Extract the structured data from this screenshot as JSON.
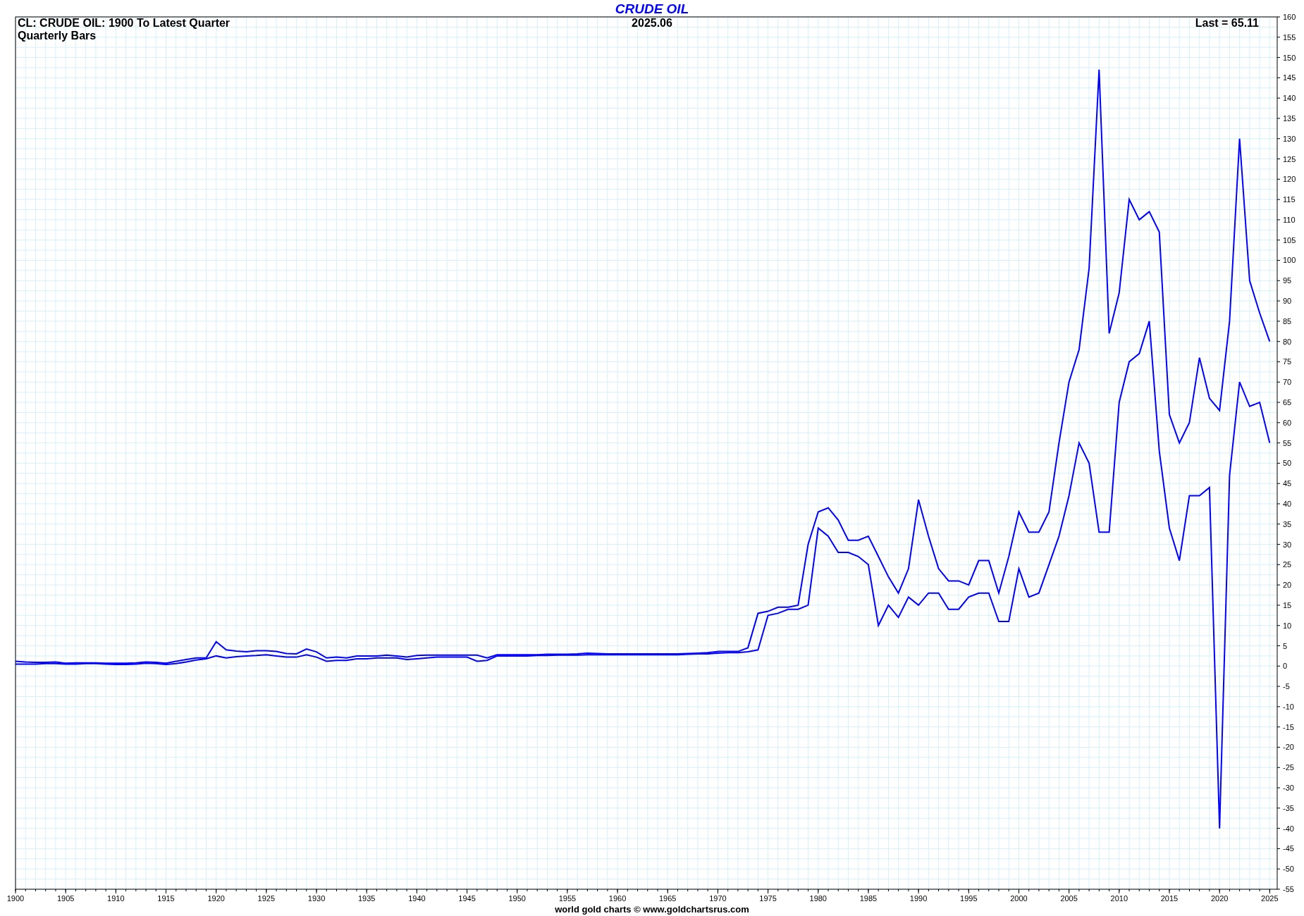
{
  "title": "CRUDE OIL",
  "subtitle_lines": [
    "CL: CRUDE OIL: 1900 To Latest Quarter",
    "Quarterly Bars"
  ],
  "date": "2025.06",
  "last_label": "Last = 65.11",
  "footer": "world gold charts © www.goldchartsrus.com",
  "chart_data": {
    "type": "line",
    "grid": true,
    "xlim": [
      1900,
      2025.75
    ],
    "ylim": [
      -55,
      160
    ],
    "xticks": [
      1900,
      1905,
      1910,
      1915,
      1920,
      1925,
      1930,
      1935,
      1940,
      1945,
      1950,
      1955,
      1960,
      1965,
      1970,
      1975,
      1980,
      1985,
      1990,
      1995,
      2000,
      2005,
      2010,
      2015,
      2020,
      2025
    ],
    "yticks": [
      -55,
      -50,
      -45,
      -40,
      -35,
      -30,
      -25,
      -20,
      -15,
      -10,
      -5,
      0,
      5,
      10,
      15,
      20,
      25,
      30,
      35,
      40,
      45,
      50,
      55,
      60,
      65,
      70,
      75,
      80,
      85,
      90,
      95,
      100,
      105,
      110,
      115,
      120,
      125,
      130,
      135,
      140,
      145,
      150,
      155,
      160
    ],
    "x": [
      1900,
      1901,
      1902,
      1903,
      1904,
      1905,
      1906,
      1907,
      1908,
      1909,
      1910,
      1911,
      1912,
      1913,
      1914,
      1915,
      1916,
      1917,
      1918,
      1919,
      1920,
      1921,
      1922,
      1923,
      1924,
      1925,
      1926,
      1927,
      1928,
      1929,
      1930,
      1931,
      1932,
      1933,
      1934,
      1935,
      1936,
      1937,
      1938,
      1939,
      1940,
      1941,
      1942,
      1943,
      1944,
      1945,
      1946,
      1947,
      1948,
      1949,
      1950,
      1951,
      1952,
      1953,
      1954,
      1955,
      1956,
      1957,
      1958,
      1959,
      1960,
      1961,
      1962,
      1963,
      1964,
      1965,
      1966,
      1967,
      1968,
      1969,
      1970,
      1971,
      1972,
      1973,
      1974,
      1975,
      1976,
      1977,
      1978,
      1979,
      1980,
      1981,
      1982,
      1983,
      1984,
      1985,
      1986,
      1987,
      1988,
      1989,
      1990,
      1991,
      1992,
      1993,
      1994,
      1995,
      1996,
      1997,
      1998,
      1999,
      2000,
      2001,
      2002,
      2003,
      2004,
      2005,
      2006,
      2007,
      2008,
      2009,
      2010,
      2011,
      2012,
      2013,
      2014,
      2015,
      2016,
      2017,
      2018,
      2019,
      2020,
      2021,
      2022,
      2023,
      2024,
      2025
    ],
    "series": [
      {
        "color": "#0000ff",
        "values": [
          1.2,
          1.0,
          0.9,
          0.9,
          1.0,
          0.7,
          0.8,
          0.8,
          0.8,
          0.7,
          0.7,
          0.7,
          0.8,
          1.0,
          0.9,
          0.7,
          1.2,
          1.6,
          2.0,
          2.0,
          6.0,
          4.0,
          3.7,
          3.5,
          3.8,
          3.8,
          3.6,
          3.1,
          3.0,
          4.2,
          3.5,
          2.0,
          2.2,
          2.0,
          2.5,
          2.5,
          2.5,
          2.7,
          2.5,
          2.2,
          2.6,
          2.7,
          2.7,
          2.7,
          2.7,
          2.7,
          2.7,
          2.0,
          2.8,
          2.8,
          2.8,
          2.8,
          2.8,
          2.9,
          2.9,
          2.9,
          3.0,
          3.2,
          3.1,
          3.0,
          3.0,
          3.0,
          3.0,
          3.0,
          3.0,
          3.0,
          3.0,
          3.1,
          3.2,
          3.3,
          3.6,
          3.6,
          3.6,
          4.5,
          13.0,
          13.5,
          14.5,
          14.5,
          15.0,
          30.0,
          38.0,
          39.0,
          36.0,
          31.0,
          31.0,
          32.0,
          27.0,
          22.0,
          18.0,
          24.0,
          41.0,
          32.0,
          24.0,
          21.0,
          21.0,
          20.0,
          26.0,
          26.0,
          18.0,
          27.0,
          38.0,
          33.0,
          33.0,
          38.0,
          55.0,
          70.0,
          78.0,
          98.0,
          147.0,
          82.0,
          92.0,
          115.0,
          110.0,
          112.0,
          107.0,
          62.0,
          55.0,
          60.0,
          76.0,
          66.0,
          63.0,
          85.0,
          130.0,
          95.0,
          87.0,
          80.0
        ]
      },
      {
        "color": "#0000ff",
        "values": [
          0.5,
          0.5,
          0.5,
          0.6,
          0.6,
          0.5,
          0.5,
          0.6,
          0.6,
          0.5,
          0.4,
          0.4,
          0.5,
          0.7,
          0.6,
          0.4,
          0.6,
          1.0,
          1.5,
          1.8,
          2.5,
          2.0,
          2.3,
          2.5,
          2.6,
          2.8,
          2.5,
          2.2,
          2.2,
          2.8,
          2.2,
          1.2,
          1.4,
          1.4,
          1.8,
          1.8,
          2.0,
          2.0,
          2.0,
          1.6,
          1.8,
          2.0,
          2.2,
          2.2,
          2.2,
          2.2,
          1.2,
          1.4,
          2.5,
          2.5,
          2.5,
          2.5,
          2.6,
          2.6,
          2.7,
          2.7,
          2.7,
          2.8,
          2.8,
          2.8,
          2.8,
          2.8,
          2.8,
          2.8,
          2.8,
          2.8,
          2.8,
          2.9,
          3.0,
          3.0,
          3.2,
          3.3,
          3.3,
          3.5,
          4.0,
          12.5,
          13.0,
          14.0,
          14.0,
          15.0,
          34.0,
          32.0,
          28.0,
          28.0,
          27.0,
          25.0,
          10.0,
          15.0,
          12.0,
          17.0,
          15.0,
          18.0,
          18.0,
          14.0,
          14.0,
          17.0,
          18.0,
          18.0,
          11.0,
          11.0,
          24.0,
          17.0,
          18.0,
          25.0,
          32.0,
          42.0,
          55.0,
          50.0,
          33.0,
          33.0,
          65.0,
          75.0,
          77.0,
          85.0,
          53.0,
          34.0,
          26.0,
          42.0,
          42.0,
          44.0,
          -40.0,
          47.0,
          70.0,
          64.0,
          65.0,
          55.0
        ]
      }
    ]
  }
}
